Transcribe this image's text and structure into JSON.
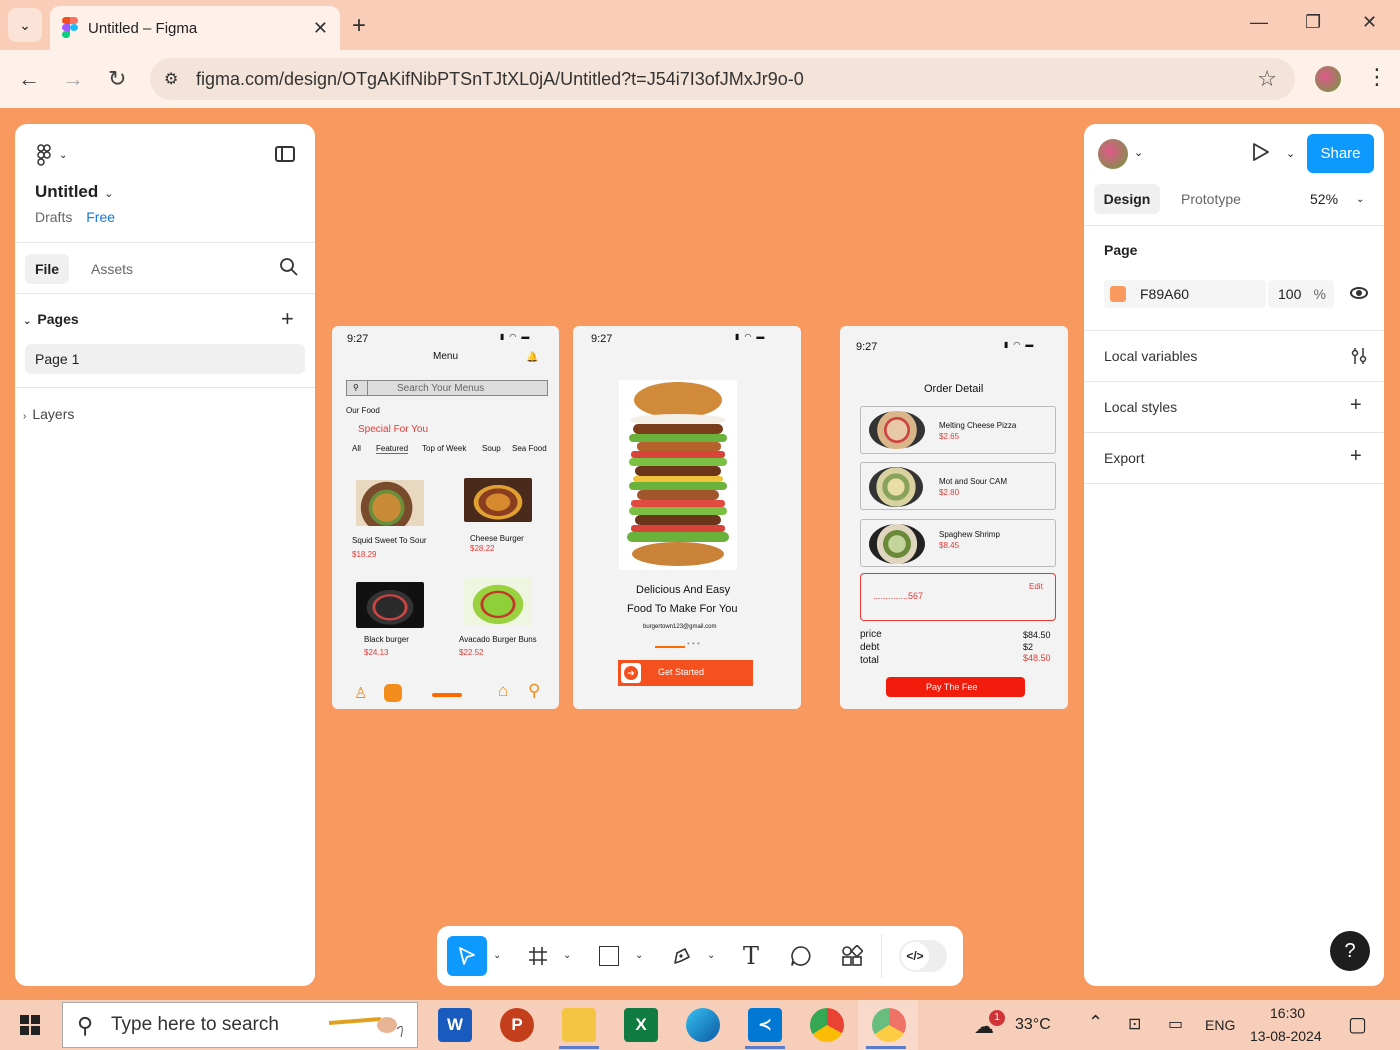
{
  "browser": {
    "tab_title": "Untitled – Figma",
    "url": "figma.com/design/OTgAKifNibPTSnTJtXL0jA/Untitled?t=J54i7I3ofJMxJr9o-0"
  },
  "left_panel": {
    "file_name": "Untitled",
    "location": "Drafts",
    "plan": "Free",
    "tab_file": "File",
    "tab_assets": "Assets",
    "pages_label": "Pages",
    "pages": [
      "Page 1"
    ],
    "layers_label": "Layers"
  },
  "right_panel": {
    "share_label": "Share",
    "tab_design": "Design",
    "tab_prototype": "Prototype",
    "zoom": "52%",
    "page_label": "Page",
    "page_color_hex": "F89A60",
    "page_color": "#F89A60",
    "page_opacity": "100",
    "opacity_unit": "%",
    "sections": [
      "Local variables",
      "Local styles",
      "Export"
    ]
  },
  "toolbar": {
    "tools": [
      "move-tool",
      "frame-tool",
      "shape-tool",
      "pen-tool",
      "text-tool",
      "comment-tool",
      "actions-tool"
    ],
    "dev_mode": "</>"
  },
  "phone1": {
    "time": "9:27",
    "title": "Menu",
    "search_placeholder": "Search Your Menus",
    "section": "Our Food",
    "heading": "Special For You",
    "categories": [
      "All",
      "Featured",
      "Top of Week",
      "Soup",
      "Sea Food"
    ],
    "items": [
      {
        "name": "Squid Sweet To Sour",
        "price": "$18.29"
      },
      {
        "name": "Cheese Burger",
        "price": "$28.22"
      },
      {
        "name": "Black burger",
        "price": "$24.13"
      },
      {
        "name": "Avacado Burger Buns",
        "price": "$22.52"
      }
    ]
  },
  "phone2": {
    "time": "9:27",
    "headline_1": "Delicious And Easy",
    "headline_2": "Food To Make For You",
    "email": "burgertown123@gmail.com",
    "cta": "Get Started"
  },
  "phone3": {
    "time": "9:27",
    "title": "Order Detail",
    "items": [
      {
        "name": "Melting Cheese Pizza",
        "price": "$2.65"
      },
      {
        "name": "Mot and Sour CAM",
        "price": "$2.80"
      },
      {
        "name": "Spaghew Shrimp",
        "price": "$8.45"
      }
    ],
    "card_number": "..............567",
    "edit": "Edit",
    "labels": [
      "price",
      "debt",
      "total"
    ],
    "values": [
      "$84.50",
      "$2",
      "$48.50"
    ],
    "pay_button": "Pay The Fee"
  },
  "taskbar": {
    "search_placeholder": "Type here to search",
    "weather_badge": "1",
    "temperature": "33°C",
    "language": "ENG",
    "time": "16:30",
    "date": "13-08-2024"
  }
}
